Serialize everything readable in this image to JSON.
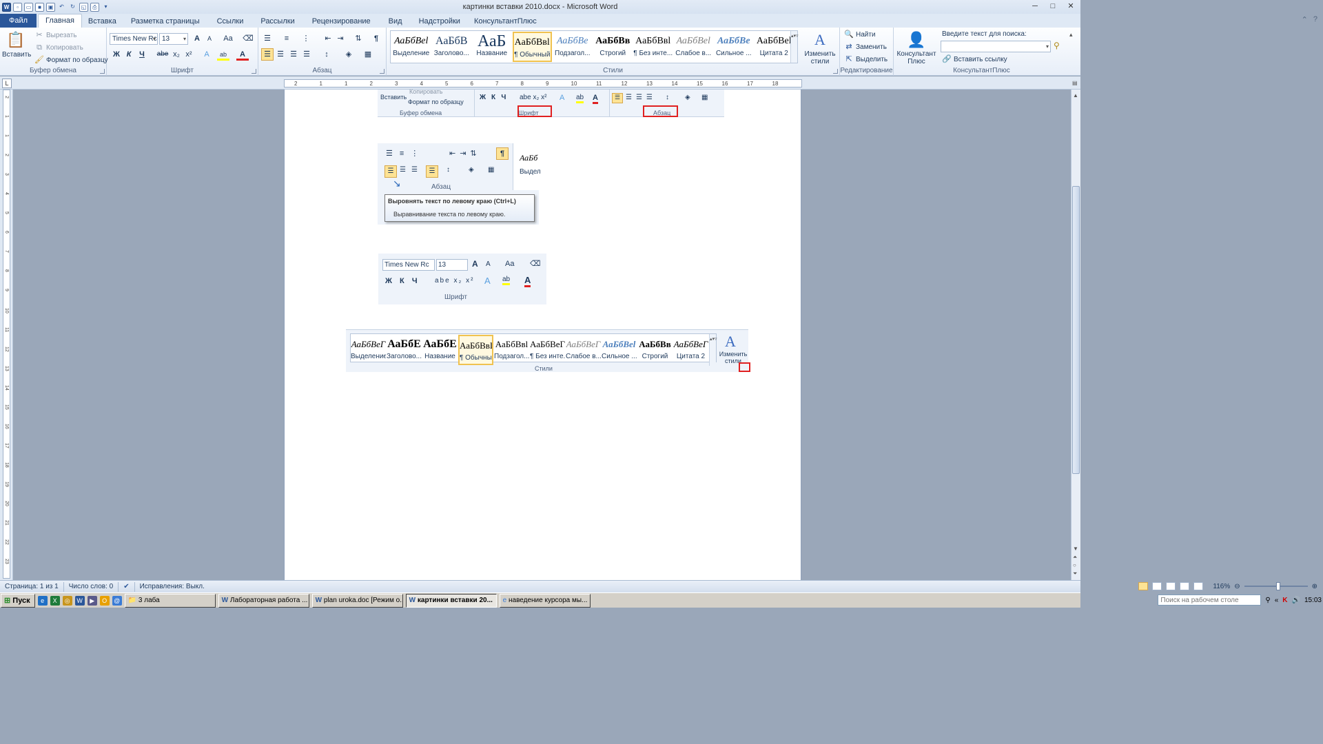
{
  "window": {
    "title": "картинки вставки 2010.docx - Microsoft Word",
    "app_letter": "W"
  },
  "qat": [
    "save",
    "undo",
    "redo",
    "open",
    "new",
    "print-preview",
    "print",
    "customize"
  ],
  "tabs": [
    {
      "label": "Файл"
    },
    {
      "label": "Главная"
    },
    {
      "label": "Вставка"
    },
    {
      "label": "Разметка страницы"
    },
    {
      "label": "Ссылки"
    },
    {
      "label": "Рассылки"
    },
    {
      "label": "Рецензирование"
    },
    {
      "label": "Вид"
    },
    {
      "label": "Надстройки"
    },
    {
      "label": "КонсультантПлюс"
    }
  ],
  "ribbon": {
    "clipboard": {
      "label": "Буфер обмена",
      "paste": "Вставить",
      "cut": "Вырезать",
      "copy": "Копировать",
      "format_painter": "Формат по образцу"
    },
    "font": {
      "label": "Шрифт",
      "family": "Times New Rc",
      "size": "13",
      "grow": "A",
      "shrink": "A",
      "case": "Aa",
      "bold": "Ж",
      "italic": "К",
      "underline": "Ч",
      "strike": "abe",
      "sub": "x₂",
      "sup": "x²",
      "effects": "A",
      "highlight": "ab",
      "color": "A"
    },
    "paragraph": {
      "label": "Абзац",
      "pilcrow": "¶"
    },
    "styles": {
      "label": "Стили",
      "items": [
        {
          "sample": "АаБбВеl",
          "name": "Выделение"
        },
        {
          "sample": "АаБбВ",
          "name": "Заголово..."
        },
        {
          "sample": "АаБ",
          "name": "Название"
        },
        {
          "sample": "АаБбВвl",
          "name": "¶ Обычный"
        },
        {
          "sample": "АаБбВе",
          "name": "Подзагол..."
        },
        {
          "sample": "АаБбВв",
          "name": "Строгий"
        },
        {
          "sample": "АаБбВвl",
          "name": "¶ Без инте..."
        },
        {
          "sample": "АаБбВеl",
          "name": "Слабое в..."
        },
        {
          "sample": "АаБбВе",
          "name": "Сильное ..."
        },
        {
          "sample": "АаБбВеl",
          "name": "Цитата 2"
        }
      ],
      "change": "Изменить стили"
    },
    "editing": {
      "label": "Редактирование",
      "find": "Найти",
      "replace": "Заменить",
      "select": "Выделить"
    },
    "kplus": {
      "label": "КонсультантПлюс",
      "btn": "Консультант Плюс",
      "search_label": "Введите текст для поиска:",
      "insert_link": "Вставить ссылку"
    }
  },
  "ruler": {
    "h": [
      "2",
      "1",
      "1",
      "2",
      "3",
      "4",
      "5",
      "6",
      "7",
      "8",
      "9",
      "10",
      "11",
      "12",
      "13",
      "14",
      "15",
      "16",
      "17",
      "18"
    ],
    "v": [
      "2",
      "1",
      "1",
      "2",
      "3",
      "4",
      "5",
      "6",
      "7",
      "8",
      "9",
      "10",
      "11",
      "12",
      "13",
      "14",
      "15",
      "16",
      "17",
      "18",
      "19",
      "20",
      "21",
      "22",
      "23"
    ]
  },
  "doc": {
    "img1": {
      "paste": "Вставить",
      "copy": "Копировать",
      "format": "Формат по образцу",
      "g1": "Буфер обмена",
      "g2": "Шрифт",
      "g3": "Абзац"
    },
    "img2": {
      "group": "Абзац",
      "gallery_sample": "АаБб",
      "gallery_name": "Выдел",
      "tip_title": "Выровнять текст по левому краю (Ctrl+L)",
      "tip_body": "Выравнивание текста по левому краю."
    },
    "img3": {
      "family": "Times New Rc",
      "size": "13",
      "group": "Шрифт"
    },
    "img4": {
      "items": [
        {
          "sample": "АаБбВеГ",
          "name": "Выделение"
        },
        {
          "sample": "АаБбЕ",
          "name": "Заголово..."
        },
        {
          "sample": "АаБбЕ",
          "name": "Название"
        },
        {
          "sample": "АаБбВвГ",
          "name": "¶ Обычный"
        },
        {
          "sample": "АаБбВвl",
          "name": "Подзагол..."
        },
        {
          "sample": "АаБбВеГ",
          "name": "¶ Без инте..."
        },
        {
          "sample": "АаБбВеГ",
          "name": "Слабое в..."
        },
        {
          "sample": "АаБбВеl",
          "name": "Сильное ..."
        },
        {
          "sample": "АаБбВв",
          "name": "Строгий"
        },
        {
          "sample": "АаБбВеГ",
          "name": "Цитата 2"
        }
      ],
      "change": "Изменить стили",
      "group": "Стили"
    }
  },
  "status": {
    "page": "Страница: 1 из 1",
    "words": "Число слов: 0",
    "track": "Исправления: Выкл.",
    "zoom": "116%"
  },
  "taskbar": {
    "start": "Пуск",
    "tasks": [
      "3 лаба",
      "Лабораторная работа ...",
      "plan uroka.doc [Режим о...",
      "картинки вставки 20...",
      "наведение курсора мы..."
    ],
    "search_placeholder": "Поиск на рабочем столе",
    "time": "15:03"
  },
  "colors": {
    "accent": "#2b579a",
    "highlight": "#fde395",
    "red": "#e02020"
  }
}
